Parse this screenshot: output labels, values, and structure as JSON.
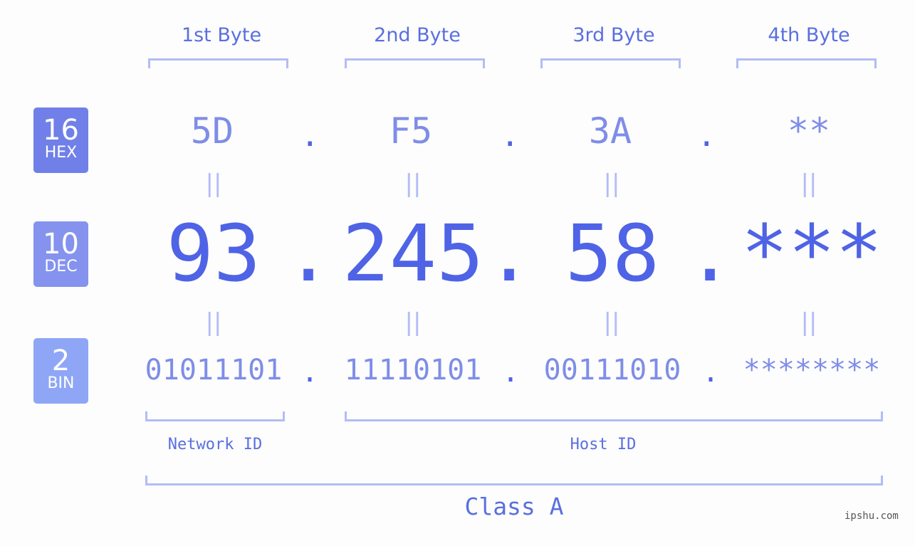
{
  "badges": [
    {
      "num": "16",
      "label": "HEX",
      "color": "#7080e8"
    },
    {
      "num": "10",
      "label": "DEC",
      "color": "#8593ee"
    },
    {
      "num": "2",
      "label": "BIN",
      "color": "#8ea6f5"
    }
  ],
  "byte_headers": [
    "1st Byte",
    "2nd Byte",
    "3rd Byte",
    "4th Byte"
  ],
  "hex": [
    "5D",
    "F5",
    "3A",
    "**"
  ],
  "dec": [
    "93",
    "245",
    "58",
    "***"
  ],
  "bin": [
    "01011101",
    "11110101",
    "00111010",
    "********"
  ],
  "separator": ".",
  "equals": "||",
  "network_label": "Network ID",
  "host_label": "Host ID",
  "class_label": "Class A",
  "watermark": "ipshu.com",
  "colors": {
    "accent": "#4f63e6",
    "light": "#7f8de8",
    "bracket": "#b3bcf6"
  }
}
